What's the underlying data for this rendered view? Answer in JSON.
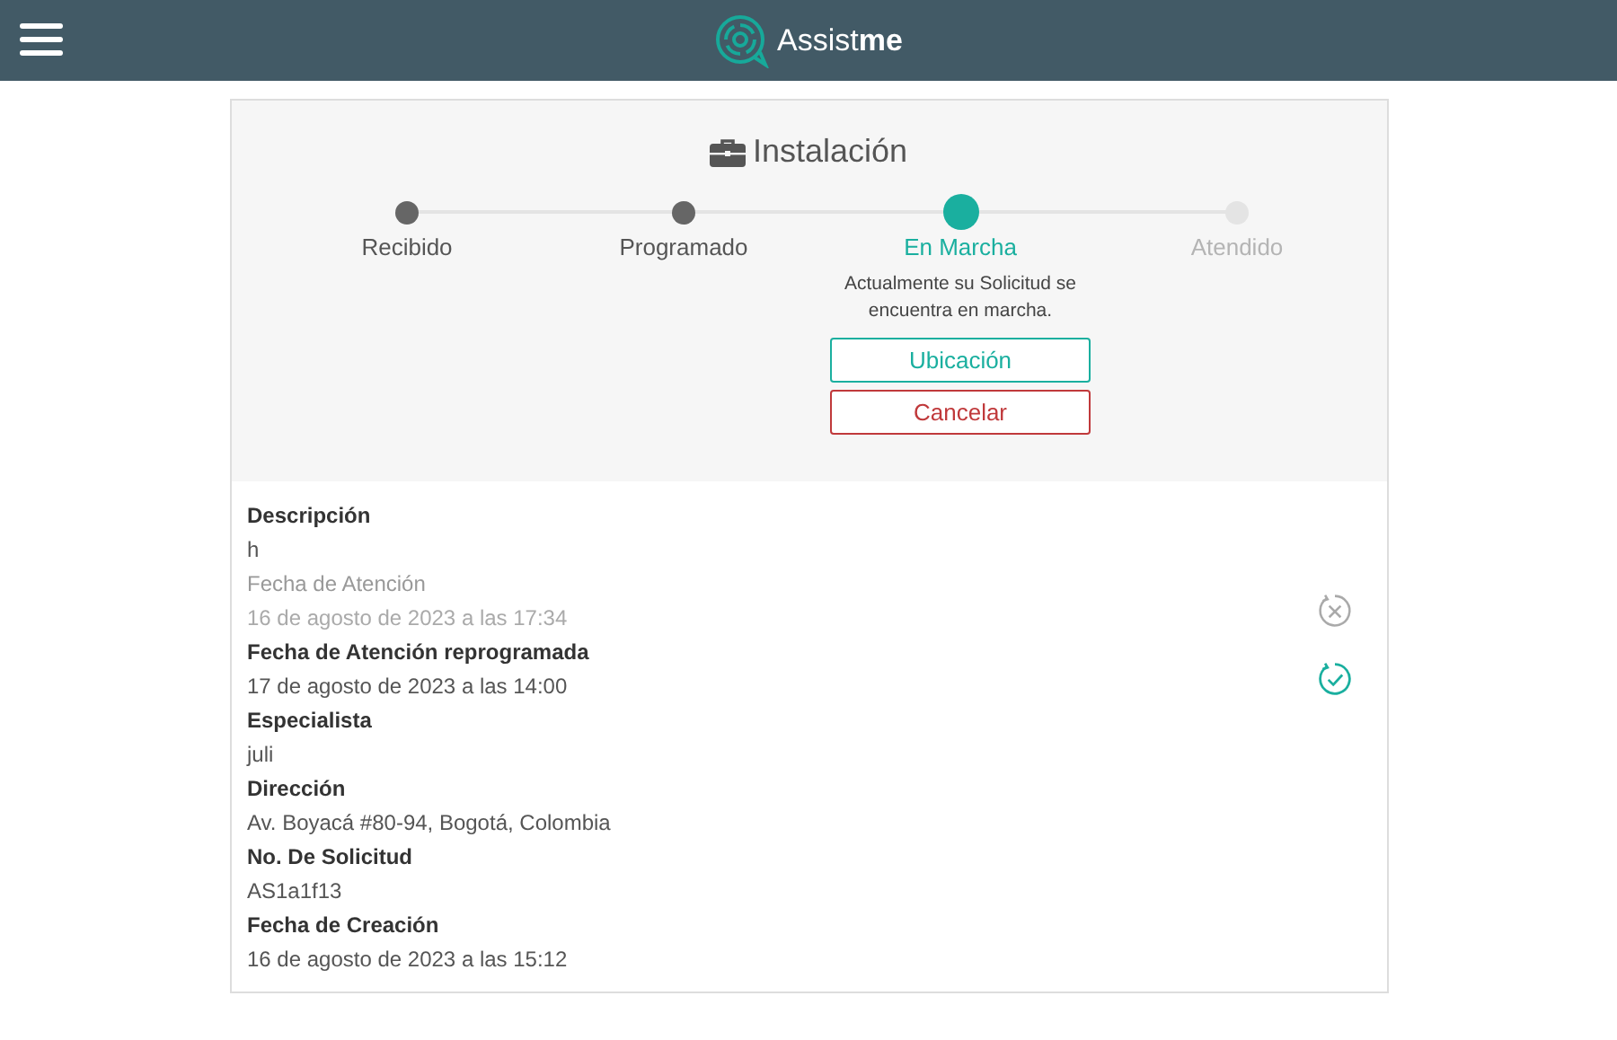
{
  "header": {
    "logo": "Assist**me**"
  },
  "card": {
    "title": "Instalación",
    "steps": [
      {
        "label": "Recibido",
        "done": true,
        "selected": false
      },
      {
        "label": "Programado",
        "done": true,
        "selected": false
      },
      {
        "label": "En Marcha",
        "done": false,
        "selected": true,
        "note": "Actualmente su Solicitud se encuentra en marcha.",
        "actions": [
          {
            "label": "Ubicación",
            "kind": "primary"
          },
          {
            "label": "Cancelar",
            "kind": "danger"
          }
        ]
      },
      {
        "label": "Atendido",
        "done": false,
        "selected": false
      }
    ],
    "fields": [
      {
        "label": "Descripción",
        "value": "h",
        "kind": "plain"
      },
      {
        "label": "Fecha de Atención",
        "value": "16 de agosto de 2023 a las 17:34",
        "kind": "cancelled"
      },
      {
        "label": "Fecha de Atención reprogramada",
        "value": "17 de agosto de 2023 a las 14:00",
        "kind": "confirmed"
      },
      {
        "label": "Especialista",
        "value": "juli",
        "kind": "plain"
      },
      {
        "label": "Dirección",
        "value": "Av. Boyacá #80-94, Bogotá, Colombia",
        "kind": "plain"
      },
      {
        "label": "No. De Solicitud",
        "value": "AS1a1f13",
        "kind": "plain"
      },
      {
        "label": "Fecha de Creación",
        "value": "16 de agosto de 2023 a las 15:12",
        "kind": "plain"
      }
    ]
  }
}
